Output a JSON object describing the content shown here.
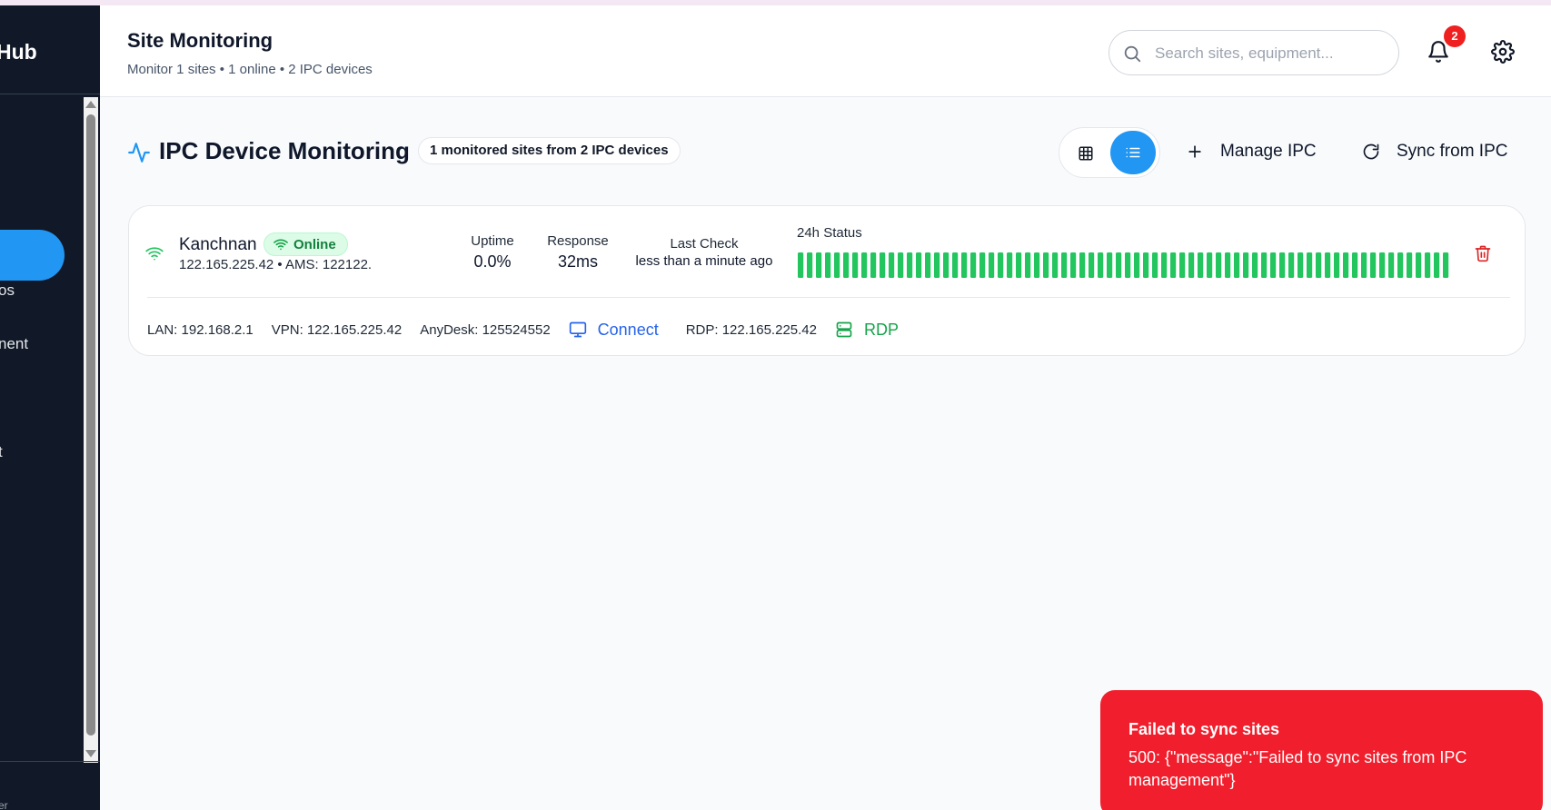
{
  "sidebar": {
    "brand": "Hub",
    "nav_items": [
      {
        "label": "os"
      },
      {
        "label": "nent"
      },
      {
        "label": "t"
      }
    ],
    "footer": "er"
  },
  "header": {
    "title": "Site Monitoring",
    "subtitle": "Monitor 1 sites • 1 online • 2 IPC devices",
    "search_placeholder": "Search sites, equipment...",
    "notification_count": "2"
  },
  "section": {
    "title": "IPC Device Monitoring",
    "badge": "1 monitored sites from 2 IPC devices",
    "manage_label": "Manage IPC",
    "sync_label": "Sync from IPC",
    "active_view": "list"
  },
  "site": {
    "name": "Kanchnan",
    "status": "Online",
    "meta": "122.165.225.42 • AMS: 122122.",
    "uptime_label": "Uptime",
    "uptime_value": "0.0%",
    "response_label": "Response",
    "response_value": "32ms",
    "last_check_label": "Last Check",
    "last_check_value": "less than a minute ago",
    "status_label": "24h Status",
    "status_history_count": 72,
    "status_history_state": "up",
    "lan": "LAN: 192.168.2.1",
    "vpn": "VPN: 122.165.225.42",
    "anydesk": "AnyDesk: 125524552",
    "connect_label": "Connect",
    "rdp": "RDP: 122.165.225.42",
    "rdp_label": "RDP"
  },
  "toast": {
    "title": "Failed to sync sites",
    "message": "500: {\"message\":\"Failed to sync sites from IPC management\"}"
  },
  "colors": {
    "accent": "#2196f3",
    "online": "#22c55e",
    "error": "#f11f2d",
    "sidebar_bg": "#111827"
  }
}
